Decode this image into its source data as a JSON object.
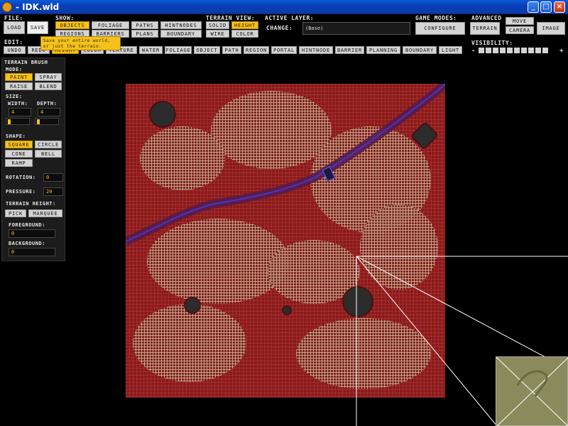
{
  "window": {
    "title": "- IDK.wld"
  },
  "file": {
    "label": "FILE:",
    "load": "Load",
    "save": "Save"
  },
  "show": {
    "label": "SHOW:",
    "items": [
      "Objects",
      "Foliage",
      "Paths",
      "HintNodes",
      "Regions",
      "Barriers",
      "Plans",
      "Boundary"
    ]
  },
  "terrain_view": {
    "label": "TERRAIN VIEW:",
    "items": [
      "Solid",
      "Height",
      "Wire",
      "Color"
    ]
  },
  "active_layer": {
    "label": "ACTIVE LAYER:",
    "change_label": "CHANGE:",
    "value": "(Base)"
  },
  "game_modes": {
    "label": "GAME MODES:",
    "configure": "Configure"
  },
  "advanced": {
    "label": "ADVANCED",
    "terrain": "Terrain",
    "move": "Move",
    "camera": "Camera",
    "image": "Image"
  },
  "edit": {
    "label": "EDIT:",
    "undo": "Undo",
    "redo": "Redo",
    "tabs": [
      "Height",
      "Color",
      "Texture",
      "Water",
      "Foliage",
      "Object",
      "Path",
      "Region",
      "Portal",
      "HintNode",
      "Barrier",
      "Planning",
      "Boundary",
      "Light"
    ]
  },
  "tooltip": {
    "line1": "Save your entire world,",
    "line2": "or just the terrain."
  },
  "visibility": {
    "label": "VISIBILITY:",
    "minus": "-",
    "plus": "+"
  },
  "brush": {
    "title": "TERRAIN BRUSH",
    "mode_label": "MODE:",
    "modes": [
      "Paint",
      "Spray",
      "Raise",
      "Blend"
    ],
    "size_label": "SIZE:",
    "width_label": "WIDTH:",
    "width": "4",
    "depth_label": "DEPTH:",
    "depth": "4",
    "shape_label": "SHAPE:",
    "shapes": [
      "Square",
      "Circle",
      "Cone",
      "Bell",
      "Ramp"
    ],
    "rotation_label": "ROTATION:",
    "rotation": "0",
    "pressure_label": "PRESSURE:",
    "pressure": "20",
    "terrain_height_label": "TERRAIN HEIGHT:",
    "pick": "Pick",
    "marquee": "Marquee",
    "foreground_label": "FOREGROUND:",
    "foreground": "0",
    "background_label": "BACKGROUND:",
    "background": "0"
  }
}
